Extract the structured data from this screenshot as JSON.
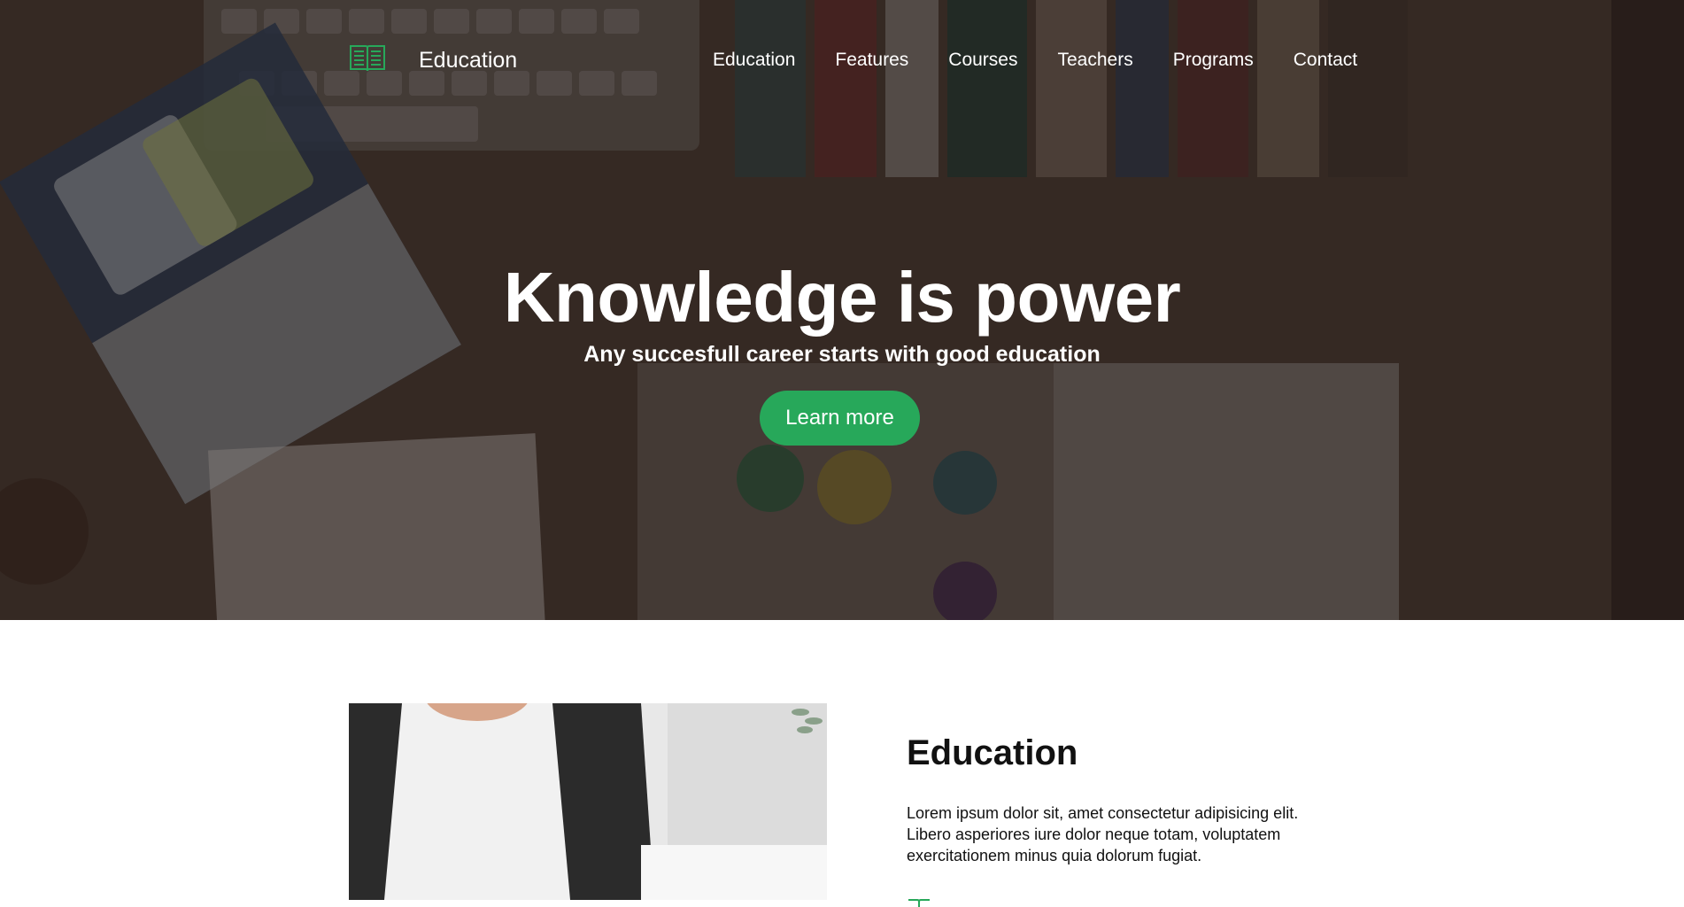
{
  "brand": {
    "name": "Education",
    "icon": "open-book-icon"
  },
  "nav": {
    "items": [
      {
        "label": "Education"
      },
      {
        "label": "Features"
      },
      {
        "label": "Courses"
      },
      {
        "label": "Teachers"
      },
      {
        "label": "Programs"
      },
      {
        "label": "Contact"
      }
    ]
  },
  "hero": {
    "title": "Knowledge is power",
    "subtitle": "Any succesfull career starts with good education",
    "cta_label": "Learn more"
  },
  "section": {
    "title": "Education",
    "text": "Lorem ipsum dolor sit, amet consectetur adipisicing elit. Libero asperiores iure dolor neque totam, voluptatem exercitationem minus quia dolorum fugiat."
  },
  "colors": {
    "accent": "#27a85a",
    "hero_text": "#ffffff",
    "body_text": "#111111"
  }
}
